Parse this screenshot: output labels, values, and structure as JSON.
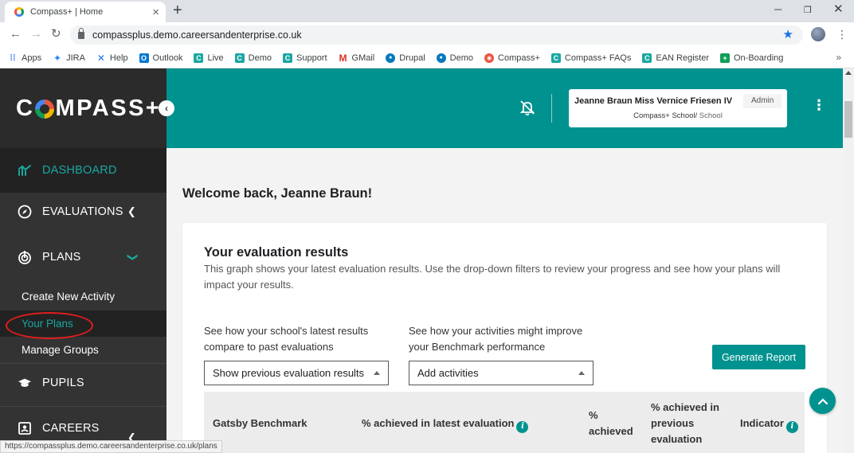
{
  "browser": {
    "tab_title": "Compass+ | Home",
    "url": "compassplus.demo.careersandenterprise.co.uk",
    "status_url": "https://compassplus.demo.careersandenterprise.co.uk/plans",
    "bookmarks": [
      {
        "label": "Apps",
        "icon": "apps-grid-icon",
        "color": "#4285f4"
      },
      {
        "label": "JIRA",
        "icon": "jira-icon",
        "color": "#2684ff"
      },
      {
        "label": "Help",
        "icon": "help-icon",
        "color": "#1a73e8"
      },
      {
        "label": "Outlook",
        "icon": "outlook-icon",
        "color": "#0078d4"
      },
      {
        "label": "Live",
        "icon": "c-icon",
        "color": "#1aa7a0"
      },
      {
        "label": "Demo",
        "icon": "c-icon",
        "color": "#1aa7a0"
      },
      {
        "label": "Support",
        "icon": "c-icon",
        "color": "#1aa7a0"
      },
      {
        "label": "GMail",
        "icon": "gmail-icon",
        "color": "#d93025"
      },
      {
        "label": "Drupal",
        "icon": "drupal-icon",
        "color": "#0678be"
      },
      {
        "label": "Demo",
        "icon": "drupal-icon",
        "color": "#0678be"
      },
      {
        "label": "Compass+",
        "icon": "compass-icon",
        "color": "#e8563f"
      },
      {
        "label": "Compass+ FAQs",
        "icon": "c-icon",
        "color": "#1aa7a0"
      },
      {
        "label": "EAN Register",
        "icon": "c-icon",
        "color": "#1aa7a0"
      },
      {
        "label": "On-Boarding",
        "icon": "plus-icon",
        "color": "#0f9d58"
      }
    ]
  },
  "app": {
    "logo_pre": "C",
    "logo_post": "MPASS+",
    "brand_color": "#00928f"
  },
  "sidebar": {
    "dashboard": "DASHBOARD",
    "evaluations": "EVALUATIONS",
    "plans": "PLANS",
    "sub_items": [
      "Create New Activity",
      "Your Plans",
      "Manage Groups"
    ],
    "pupils": "PUPILS",
    "careers": "CAREERS"
  },
  "header": {
    "user_name": "Jeanne Braun Miss Vernice Friesen IV",
    "role": "Admin",
    "school_name": "Compass+ School",
    "school_type": "School"
  },
  "main": {
    "welcome": "Welcome back, Jeanne Braun!",
    "card_title": "Your evaluation results",
    "card_desc": "This graph shows your latest evaluation results. Use the drop-down filters to review your progress and see how your plans will impact your results.",
    "filter1_label": "See how your school's latest results compare to past evaluations",
    "filter1_value": "Show previous evaluation results",
    "filter2_label": "See how your activities might improve your Benchmark performance",
    "filter2_value": "Add activities",
    "generate_btn": "Generate Report",
    "table_headers": {
      "benchmark": "Gatsby Benchmark",
      "latest": "% achieved in latest evaluation",
      "achieved": "% achieved",
      "previous": "% achieved in previous evaluation",
      "indicator": "Indicator"
    }
  }
}
